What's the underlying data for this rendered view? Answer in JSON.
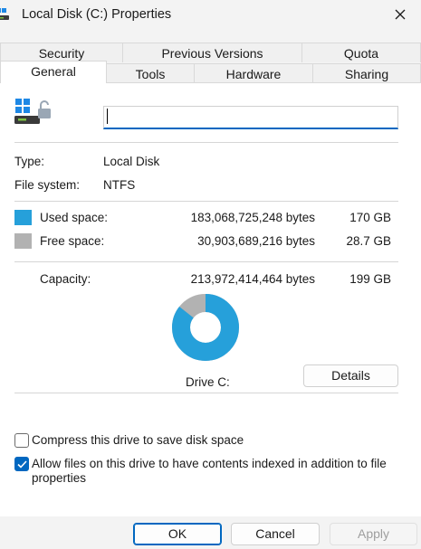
{
  "window": {
    "title": "Local Disk (C:) Properties"
  },
  "tabs_back": [
    {
      "label": "Security"
    },
    {
      "label": "Previous Versions"
    },
    {
      "label": "Quota"
    }
  ],
  "tabs_front": [
    {
      "label": "General",
      "active": true
    },
    {
      "label": "Tools"
    },
    {
      "label": "Hardware"
    },
    {
      "label": "Sharing"
    }
  ],
  "general": {
    "name_value": "",
    "type_label": "Type:",
    "type_value": "Local Disk",
    "fs_label": "File system:",
    "fs_value": "NTFS",
    "used_label": "Used space:",
    "used_bytes": "183,068,725,248 bytes",
    "used_size": "170 GB",
    "free_label": "Free space:",
    "free_bytes": "30,903,689,216 bytes",
    "free_size": "28.7 GB",
    "capacity_label": "Capacity:",
    "capacity_bytes": "213,972,414,464 bytes",
    "capacity_size": "199 GB",
    "drive_label": "Drive C:",
    "details_button": "Details",
    "used_fraction": 0.8556,
    "used_color": "#26a0da",
    "free_color": "#b2b2b2",
    "compress_label": "Compress this drive to save disk space",
    "compress_checked": false,
    "index_label": "Allow files on this drive to have contents indexed in addition to file properties",
    "index_checked": true
  },
  "footer": {
    "ok": "OK",
    "cancel": "Cancel",
    "apply": "Apply"
  }
}
